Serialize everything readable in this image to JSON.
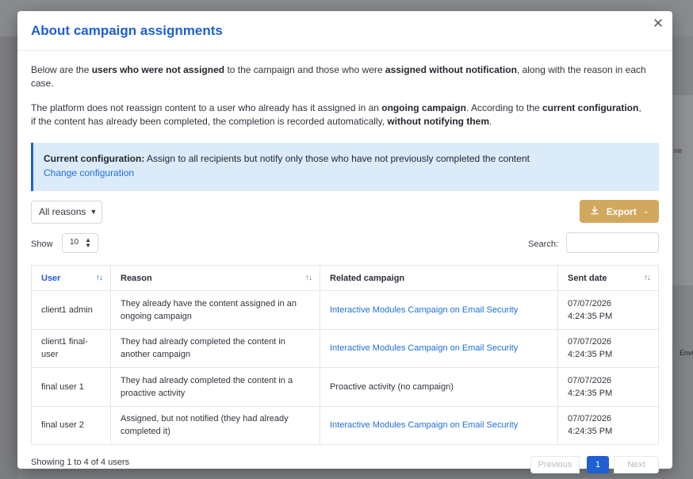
{
  "background": {
    "right_text_1": "ne",
    "right_text_2": "Envi"
  },
  "modal": {
    "title": "About campaign assignments",
    "close_glyph": "✕"
  },
  "intro": {
    "p1": [
      "Below are the ",
      "users who were not assigned",
      " to the campaign and those who were ",
      "assigned without notification",
      ", along with the reason in each case."
    ],
    "p2": [
      "The platform does not reassign content to a user who already has it assigned in an ",
      "ongoing campaign",
      ". According to the ",
      "current configuration",
      ",",
      "if the content has already been completed, the completion is recorded automatically, ",
      "without notifying them",
      "."
    ]
  },
  "config": {
    "label": "Current configuration:",
    "text": " Assign to all recipients but notify only those who have not previously completed the content",
    "link": "Change configuration"
  },
  "filter": {
    "selected": "All reasons"
  },
  "export": {
    "label": "Export"
  },
  "length": {
    "label": "Show",
    "value": "10"
  },
  "search": {
    "label": "Search:",
    "value": ""
  },
  "table": {
    "headers": [
      "User",
      "Reason",
      "Related campaign",
      "Sent date"
    ],
    "rows": [
      {
        "user": "client1 admin",
        "reason": "They already have the content assigned in an ongoing campaign",
        "campaign": "Interactive Modules Campaign on Email Security",
        "campaign_is_link": true,
        "date": "07/07/2026",
        "time": "4:24:35 PM"
      },
      {
        "user": "client1 final-user",
        "reason": "They had already completed the content in another campaign",
        "campaign": "Interactive Modules Campaign on Email Security",
        "campaign_is_link": true,
        "date": "07/07/2026",
        "time": "4:24:35 PM"
      },
      {
        "user": "final user 1",
        "reason": "They had already completed the content in a proactive activity",
        "campaign": "Proactive activity (no campaign)",
        "campaign_is_link": false,
        "date": "07/07/2026",
        "time": "4:24:35 PM"
      },
      {
        "user": "final user 2",
        "reason": "Assigned, but not notified (they had already completed it)",
        "campaign": "Interactive Modules Campaign on Email Security",
        "campaign_is_link": true,
        "date": "07/07/2026",
        "time": "4:24:35 PM"
      }
    ]
  },
  "footer": {
    "info": "Showing 1 to 4 of 4 users",
    "prev": "Previous",
    "page": "1",
    "next": "Next"
  },
  "colors": {
    "primary": "#1f5fd1",
    "export": "#d1a85e",
    "info_bg": "#dcebfa"
  }
}
